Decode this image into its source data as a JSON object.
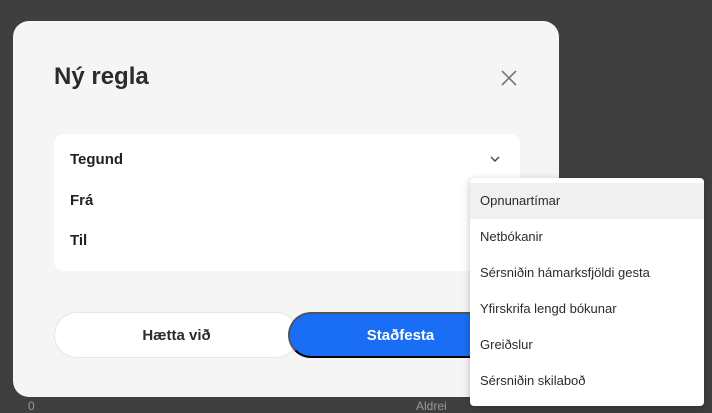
{
  "background": {
    "left_text": "0",
    "right_text": "Aldrei"
  },
  "modal": {
    "title": "Ný regla",
    "close_icon": "close-icon",
    "fields": [
      "Tegund",
      "Frá",
      "Til"
    ],
    "cancel_label": "Hætta við",
    "confirm_label": "Staðfesta",
    "accent": "#1a6ef5"
  },
  "dropdown": {
    "options": [
      "Opnunartímar",
      "Netbókanir",
      "Sérsniðin hámarksfjöldi gesta",
      "Yfirskrifa lengd bókunar",
      "Greiðslur",
      "Sérsniðin skilaboð"
    ],
    "highlighted_index": 0
  }
}
